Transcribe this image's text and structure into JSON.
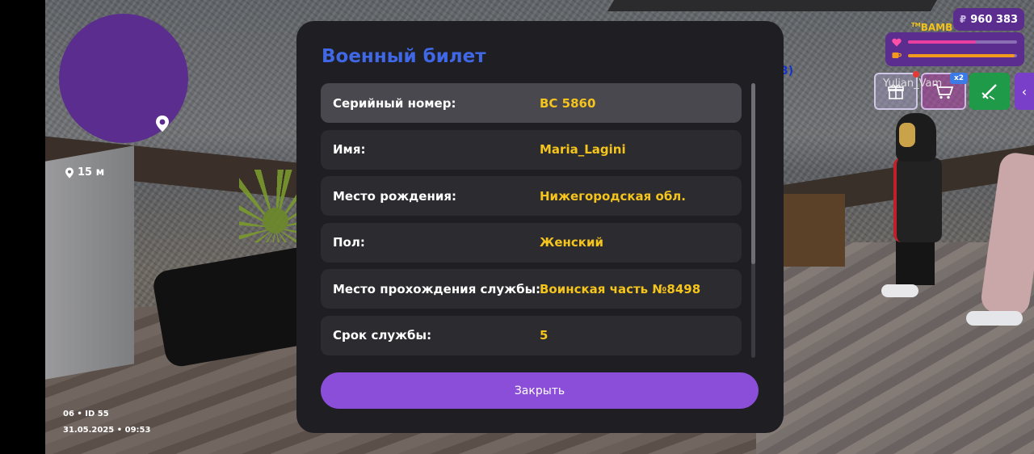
{
  "modal": {
    "title": "Военный билет",
    "rows": [
      {
        "label": "Серийный номер:",
        "value": "ВС 5860",
        "active": true
      },
      {
        "label": "Имя:",
        "value": "Maria_Lagini"
      },
      {
        "label": "Место рождения:",
        "value": "Нижегородская обл."
      },
      {
        "label": "Пол:",
        "value": "Женский"
      },
      {
        "label": "Место прохождения службы:",
        "value": "Воинская часть №8498"
      },
      {
        "label": "Срок службы:",
        "value": "5"
      }
    ],
    "close_label": "Закрыть",
    "scroll_fraction": 0.66
  },
  "hud": {
    "distance": "15 м",
    "server_line": "06 • ID 55",
    "datetime_line": "31.05.2025 • 09:53",
    "money_currency": "₽",
    "money": "960 383",
    "player_tag_prefix": "TM",
    "player_tag": "BAMB",
    "nick": "Yulian_Vam",
    "cart_badge": "x2",
    "health_fraction": 0.62,
    "hunger_fraction": 0.98,
    "colors": {
      "hud_purple": "#5a2d8f",
      "health": "#e83fa0",
      "hunger": "#f29a1e",
      "title_blue": "#3f67e6",
      "value_yellow": "#f5c41d",
      "button_purple": "#8b4ed8"
    }
  },
  "icons": [
    "location-pin-icon",
    "heart-icon",
    "coffee-cup-icon",
    "gift-icon",
    "cart-icon",
    "sword-icon",
    "chevron-left-icon"
  ]
}
